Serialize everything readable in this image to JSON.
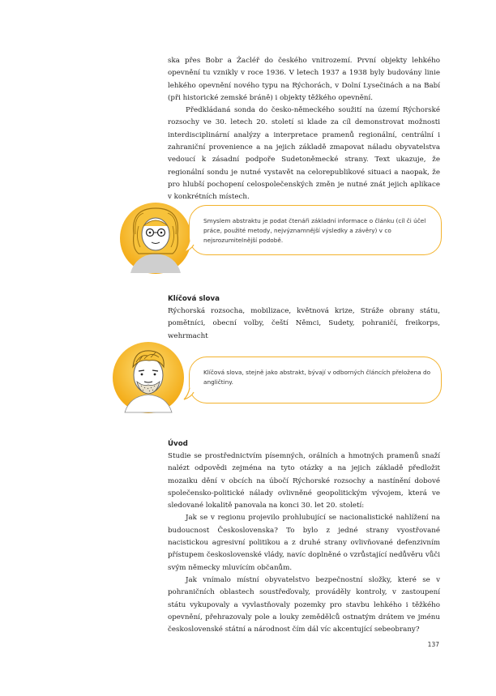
{
  "intro": {
    "lines": [
      "ska přes Bobr a Žacléř do českého vnitrozemí. První objekty lehkého opevnění tu vznikly v roce 1936. V letech 1937 a 1938 byly budovány linie lehkého opevnění nového typu na Rýchorách, v Dolní Lysečinách a na Babí (při historické zemské bráně) i objekty těžkého opevnění.",
      "Předkládaná sonda do česko-německého soužití na území Rýchorské rozsochy ve 30. letech 20. století si klade za cíl demonstrovat možnosti interdisciplinární analýzy a interpretace pramenů regionální, centrální i zahraniční provenience a na jejich základě zmapovat náladu obyvatelstva vedoucí k zásadní podpoře Sudetoněmecké strany. Text ukazuje, že regionální sondu je nutné vystavět na celorepublikové situaci a naopak, že pro hlubší pochopení celospolečenských změn je nutné znát jejich aplikace v konkrétních místech."
    ]
  },
  "bubble1": {
    "text": "Smyslem abstraktu je podat čtenáři základní informace o článku (cíl či účel práce, použité metody, nejvýznamnější výsledky a závěry) v co nejsrozumitelnější podobě."
  },
  "keywords": {
    "heading": "Klíčová slova",
    "text": "Rýchorská rozsocha, mobilizace, květnová krize, Stráže obrany státu, pomětníci, obecní volby, čeští Němci, Sudety, pohraničí, freikorps, wehrmacht"
  },
  "bubble2": {
    "text": "Klíčová slova, stejně jako abstrakt, bývají v odborných článcích přeložena do angličtiny."
  },
  "section": {
    "heading": "Úvod",
    "paragraphs": [
      "Studie se prostřednictvím písemných, orálních a hmotných pramenů snaží nalézt odpovědi zejména na tyto otázky a na jejich základě předložit mozaiku dění v obcích na úbočí Rýchorské rozsochy a nastínění dobové společensko-politické nálady ovlivněné geopolitickým vývojem, která ve sledované lokalitě panovala na konci 30. let 20. století:",
      "Jak se v regionu projevilo prohlubující se nacionalistické nahlížení na budoucnost Československa? To bylo z jedné strany vyostřované nacistickou agresivní politikou a z druhé strany ovlivňované defenzivním přístupem československé vlády, navíc doplněné o vzrůstající nedůvěru vůči svým německy mluvícím občanům.",
      "Jak vnímalo místní obyvatelstvo bezpečnostní složky, které se v pohraničních oblastech soustřeďovaly, prováděly kontroly, v zastoupení státu vykupovaly a vyvlastňovaly pozemky pro stavbu lehkého i těžkého opevnění, přehrazovaly pole a louky zemědělců ostnatým drátem ve jménu československé státní a národnost čím dál víc akcentující sebeobrany?"
    ]
  },
  "page_number": "137",
  "colors": {
    "accent": "#f3b22c",
    "avatar_gradient_light": "#fbd24a",
    "avatar_gradient_dark": "#f2a20f"
  }
}
